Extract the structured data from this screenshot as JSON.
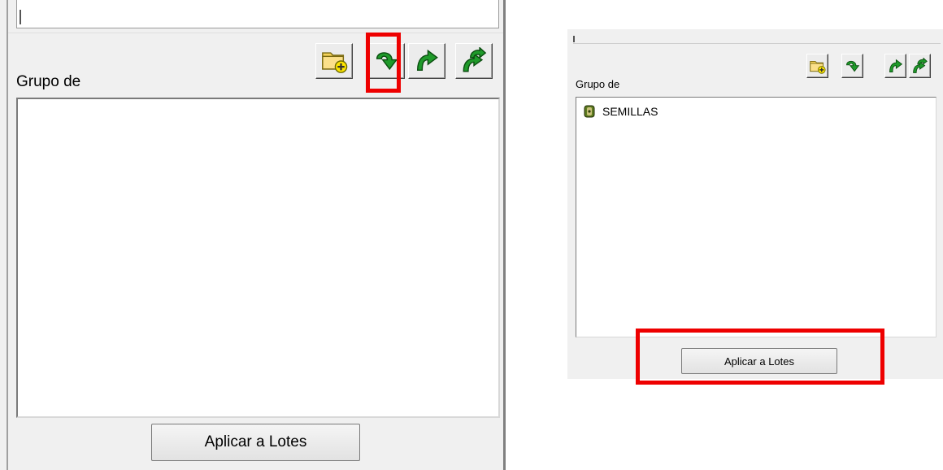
{
  "panels": {
    "zoomed": {
      "group_label": "Grupo de",
      "apply_label": "Aplicar a Lotes"
    },
    "normal": {
      "group_label": "Grupo de",
      "apply_label": "Aplicar a Lotes",
      "list_items": [
        {
          "label": "SEMILLAS",
          "icon": "seed-group-icon"
        }
      ]
    }
  },
  "toolbar": {
    "icons": [
      "new-folder-icon",
      "move-down-icon",
      "move-up-icon",
      "move-all-icon"
    ]
  },
  "highlights": [
    "move-down-button",
    "apply-to-lots-button"
  ],
  "colors": {
    "highlight": "#ee0000",
    "arrow_green": "#1f9a2a",
    "folder_yellow": "#f4d25a",
    "window_bg": "#f0f0f0"
  }
}
